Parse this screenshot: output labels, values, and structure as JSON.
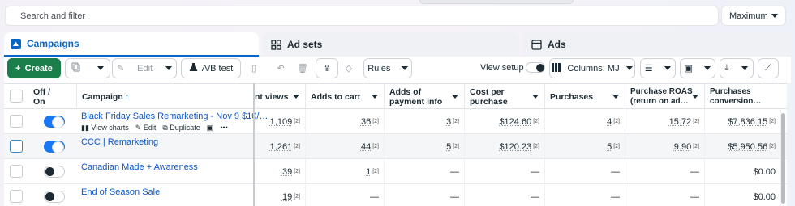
{
  "search": {
    "placeholder": "Search and filter"
  },
  "date_range": {
    "label": "Maximum"
  },
  "tabs": [
    {
      "label": "Campaigns",
      "icon": "folder-icon",
      "active": true
    },
    {
      "label": "Ad sets",
      "icon": "grid-icon"
    },
    {
      "label": "Ads",
      "icon": "ad-icon"
    }
  ],
  "toolbar": {
    "create_label": "Create",
    "edit_label": "Edit",
    "ab_test_label": "A/B test",
    "rules_label": "Rules",
    "view_setup_label": "View setup",
    "columns_label": "Columns: MJ"
  },
  "table": {
    "headers": {
      "off_on": "Off / On",
      "campaign": "Campaign",
      "views": "nt views",
      "adds_to_cart": "Adds to cart",
      "adds_payment": "Adds of payment info",
      "cost_per_purchase": "Cost per purchase",
      "purchases": "Purchases",
      "roas": "Purchase ROAS (return on ad…",
      "conv_value": "Purchases conversion…"
    },
    "row_actions": {
      "view_charts": "View charts",
      "edit": "Edit",
      "duplicate": "Duplicate"
    },
    "rows": [
      {
        "name": "Black Friday Sales Remarketing - Nov 9 $10/…",
        "on": true,
        "views": "1,109",
        "atc": "36",
        "payment": "3",
        "cpp": "$124.60",
        "purchases": "4",
        "roas": "15.72",
        "value": "$7,836.15",
        "sup": "[2]"
      },
      {
        "name": "CCC | Remarketing",
        "on": true,
        "views": "1,261",
        "atc": "44",
        "payment": "5",
        "cpp": "$120.23",
        "purchases": "5",
        "roas": "9.90",
        "value": "$5,950.56",
        "sup": "[2]"
      },
      {
        "name": "Canadian Made + Awareness",
        "on": false,
        "views": "39",
        "atc": "1",
        "payment": "—",
        "cpp": "—",
        "purchases": "—",
        "roas": "—",
        "value": "$0.00",
        "sup": "[2]"
      },
      {
        "name": "End of Season Sale",
        "on": false,
        "views": "19",
        "atc": "—",
        "payment": "—",
        "cpp": "—",
        "purchases": "—",
        "roas": "—",
        "value": "$0.00",
        "sup": "[2]"
      }
    ]
  },
  "colors": {
    "accent": "#0a66c2",
    "create": "#1a7f4b",
    "toggle_on": "#1877f2"
  }
}
